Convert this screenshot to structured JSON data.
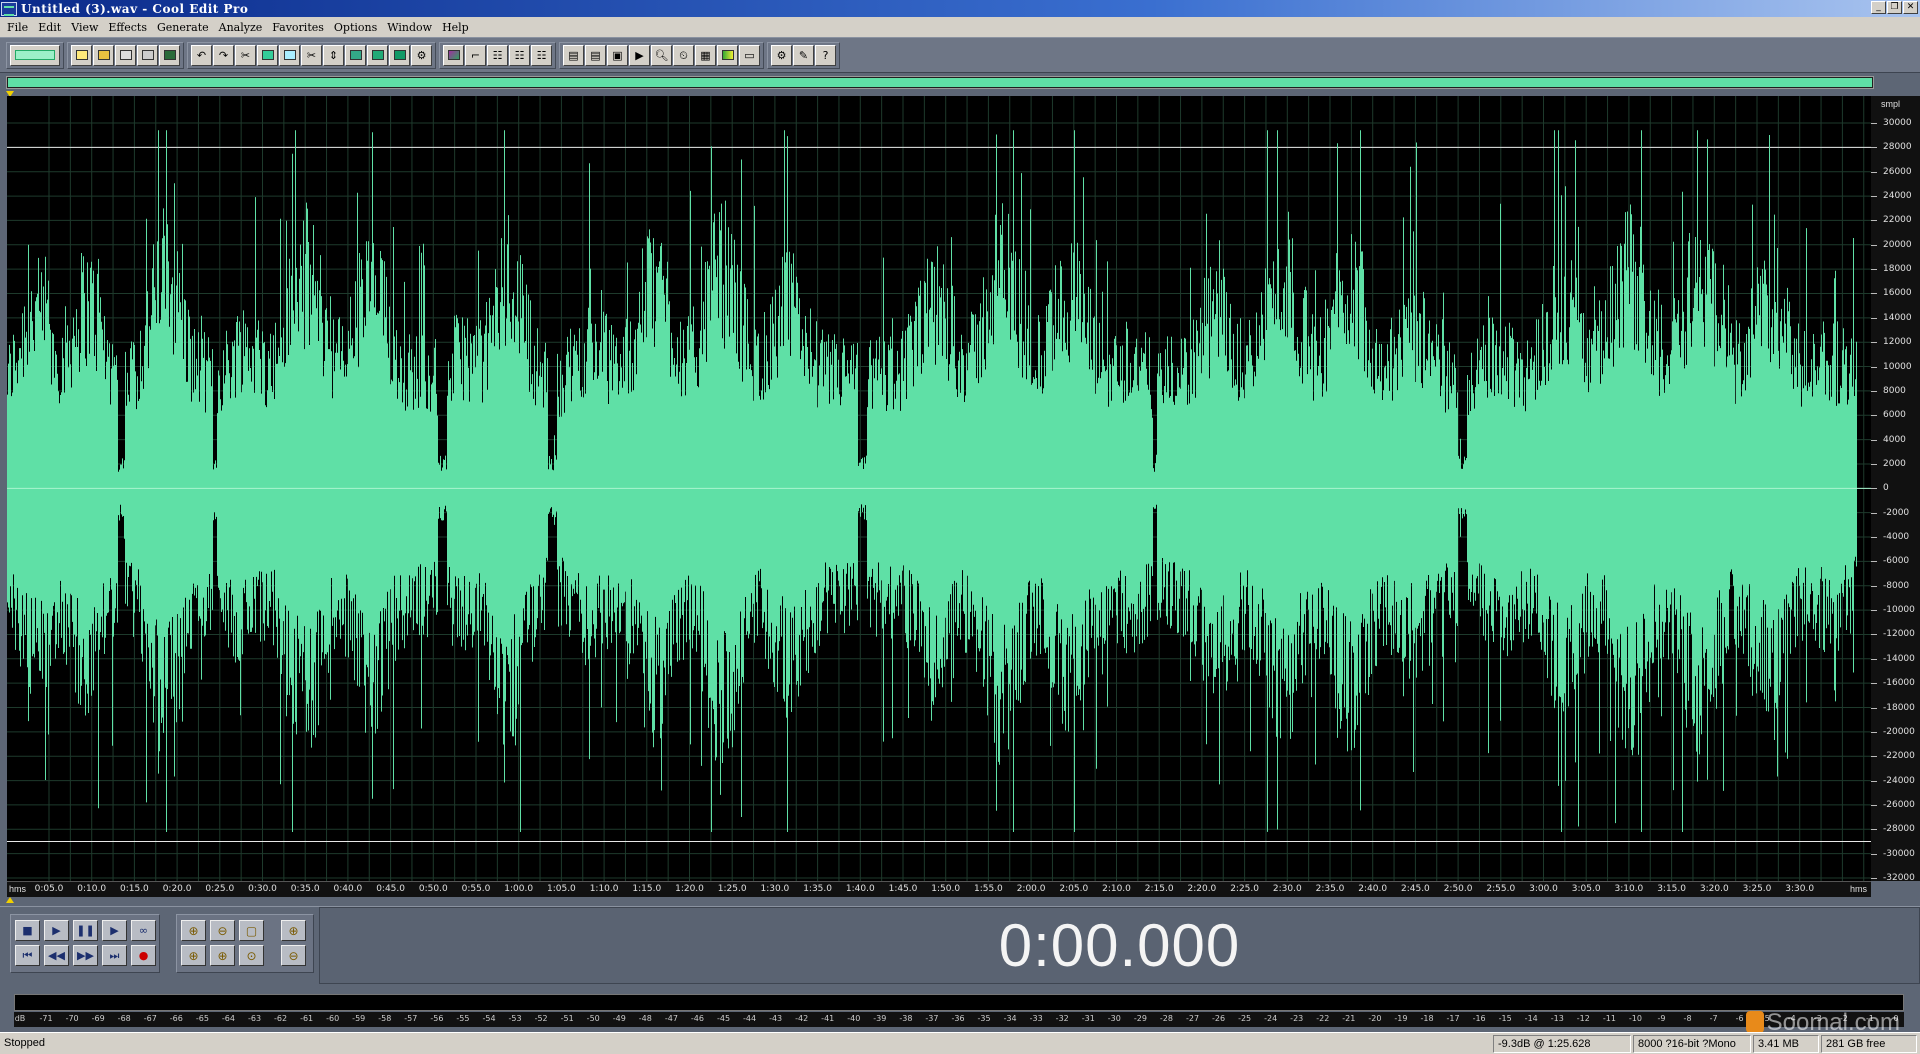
{
  "window": {
    "title": "Untitled (3).wav - Cool Edit Pro",
    "min_label": "_",
    "restore_label": "❐",
    "close_label": "✕"
  },
  "menu": [
    "File",
    "Edit",
    "View",
    "Effects",
    "Generate",
    "Analyze",
    "Favorites",
    "Options",
    "Window",
    "Help"
  ],
  "toolbar_icons": [
    "multitrack-view-icon",
    "new-file-icon",
    "open-file-icon",
    "close-file-icon",
    "save-as-icon",
    "save-icon",
    "undo-icon",
    "redo-icon",
    "repeat-last-icon",
    "copy-to-new-icon",
    "copy-icon",
    "cut-icon",
    "trim-icon",
    "paste-icon",
    "paste-to-new-icon",
    "mix-paste-icon",
    "play-clip-icon",
    "waveform-view-icon",
    "spectral-view-icon",
    "envelope-icon",
    "snap-icon",
    "grid-icon",
    "cue-list-icon",
    "play-list-icon",
    "info-icon",
    "zoom-selection-icon",
    "find-icon",
    "time-display-icon",
    "channels-icon",
    "meters-icon",
    "layout-icon",
    "settings-icon",
    "notes-icon",
    "help-icon"
  ],
  "amplitude_axis": {
    "unit": "smpl",
    "labels": [
      "30000",
      "28000",
      "26000",
      "24000",
      "22000",
      "20000",
      "18000",
      "16000",
      "14000",
      "12000",
      "10000",
      "8000",
      "6000",
      "4000",
      "2000",
      "0",
      "-2000",
      "-4000",
      "-6000",
      "-8000",
      "-10000",
      "-12000",
      "-14000",
      "-16000",
      "-18000",
      "-20000",
      "-22000",
      "-24000",
      "-26000",
      "-28000",
      "-30000",
      "-32000"
    ]
  },
  "time_axis": {
    "unit": "hms",
    "labels": [
      "0:05.0",
      "0:10.0",
      "0:15.0",
      "0:20.0",
      "0:25.0",
      "0:30.0",
      "0:35.0",
      "0:40.0",
      "0:45.0",
      "0:50.0",
      "0:55.0",
      "1:00.0",
      "1:05.0",
      "1:10.0",
      "1:15.0",
      "1:20.0",
      "1:25.0",
      "1:30.0",
      "1:35.0",
      "1:40.0",
      "1:45.0",
      "1:50.0",
      "1:55.0",
      "2:00.0",
      "2:05.0",
      "2:10.0",
      "2:15.0",
      "2:20.0",
      "2:25.0",
      "2:30.0",
      "2:35.0",
      "2:40.0",
      "2:45.0",
      "2:50.0",
      "2:55.0",
      "3:00.0",
      "3:05.0",
      "3:10.0",
      "3:15.0",
      "3:20.0",
      "3:25.0",
      "3:30.0"
    ]
  },
  "colors": {
    "waveform": "#5fe0a6",
    "background": "#000000",
    "grid": "#1e3a2c",
    "clip_line": "#e8e8e8"
  },
  "transport": {
    "stop": "■",
    "play": "▶",
    "pause": "❚❚",
    "play_to_end": "▶",
    "loop": "∞",
    "go_start": "⏮",
    "rewind": "◀◀",
    "forward": "▶▶",
    "go_end": "⏭",
    "record": "●"
  },
  "zoom": {
    "zoom_in_h": "⊕",
    "zoom_out_h": "⊖",
    "zoom_full": "▢",
    "zoom_in_v": "⊕",
    "zoom_left": "⊕",
    "zoom_right": "⊕",
    "zoom_sel": "⊙",
    "zoom_out_v": "⊖"
  },
  "time_display": "0:00.000",
  "level_meter": {
    "labels": [
      "dB",
      "-71",
      "-70",
      "-69",
      "-68",
      "-67",
      "-66",
      "-65",
      "-64",
      "-63",
      "-62",
      "-61",
      "-60",
      "-59",
      "-58",
      "-57",
      "-56",
      "-55",
      "-54",
      "-53",
      "-52",
      "-51",
      "-50",
      "-49",
      "-48",
      "-47",
      "-46",
      "-45",
      "-44",
      "-43",
      "-42",
      "-41",
      "-40",
      "-39",
      "-38",
      "-37",
      "-36",
      "-35",
      "-34",
      "-33",
      "-32",
      "-31",
      "-30",
      "-29",
      "-28",
      "-27",
      "-26",
      "-25",
      "-24",
      "-23",
      "-22",
      "-21",
      "-20",
      "-19",
      "-18",
      "-17",
      "-16",
      "-15",
      "-14",
      "-13",
      "-12",
      "-11",
      "-10",
      "-9",
      "-8",
      "-7",
      "-6",
      "-5",
      "-4",
      "-3",
      "-2",
      "-1",
      "0"
    ]
  },
  "status": {
    "state": "Stopped",
    "level_at": "-9.3dB @  1:25.628",
    "format": "8000 ?16-bit ?Mono",
    "size": "3.41 MB",
    "free": "281 GB free"
  },
  "watermark": "Soomal.com"
}
